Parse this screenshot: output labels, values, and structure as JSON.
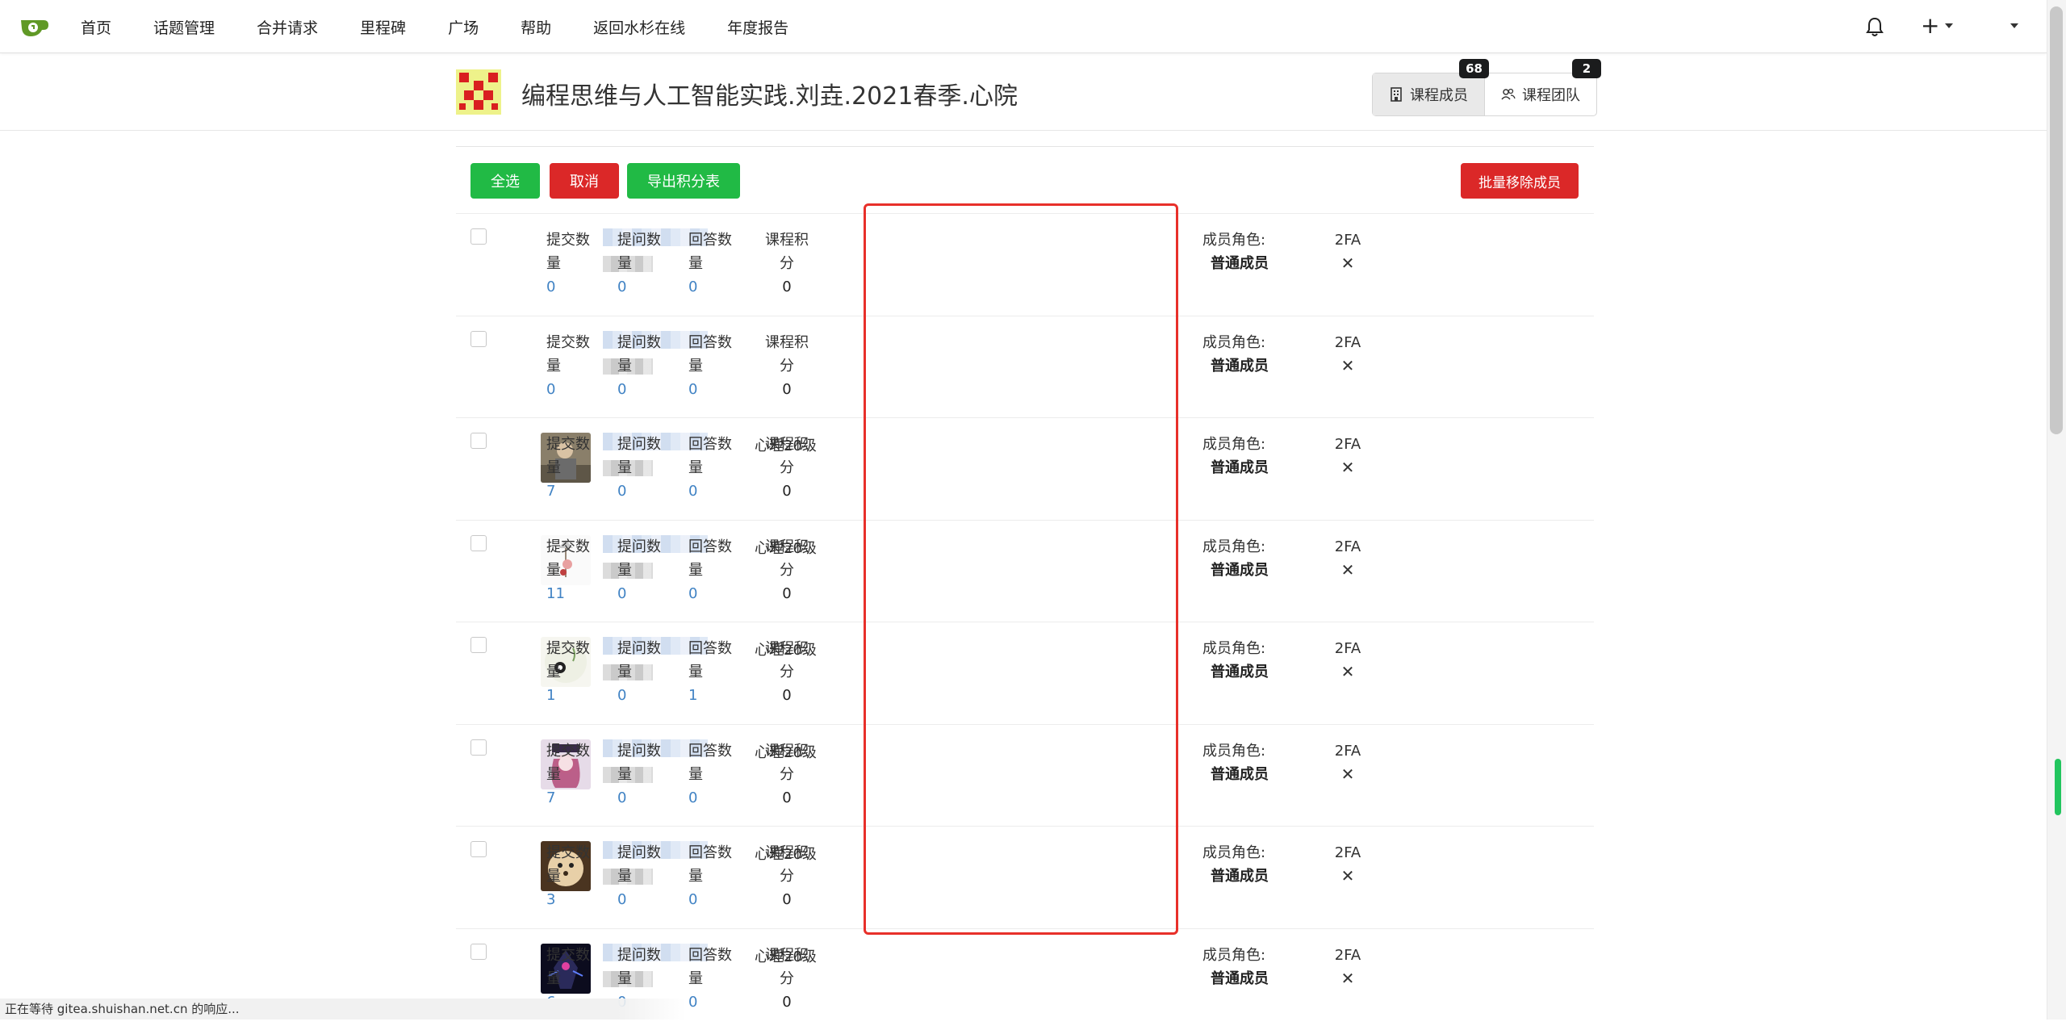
{
  "nav": {
    "items": [
      "首页",
      "话题管理",
      "合并请求",
      "里程碑",
      "广场",
      "帮助",
      "返回水杉在线",
      "年度报告"
    ]
  },
  "header": {
    "course_title": "编程思维与人工智能实践.刘垚.2021春季.心院",
    "members_label": "课程成员",
    "members_count": "68",
    "team_label": "课程团队",
    "team_count": "2"
  },
  "toolbar": {
    "select_all": "全选",
    "cancel": "取消",
    "export": "导出积分表",
    "batch_remove": "批量移除成员"
  },
  "labels": {
    "commits": "提交数量",
    "questions": "提问数量",
    "answers": "回答数量",
    "score": "课程积分",
    "role": "成员角色:",
    "twofa": "2FA",
    "twofa_status": "✕"
  },
  "members": [
    {
      "group": "",
      "commits": "0",
      "questions": "0",
      "answers": "0",
      "score": "0",
      "role": "普通成员",
      "avatar": "none"
    },
    {
      "group": "",
      "commits": "0",
      "questions": "0",
      "answers": "0",
      "score": "0",
      "role": "普通成员",
      "avatar": "none"
    },
    {
      "group": "心理20级",
      "commits": "7",
      "questions": "0",
      "answers": "0",
      "score": "0",
      "role": "普通成员",
      "avatar": "photo-elder"
    },
    {
      "group": "心理20级",
      "commits": "11",
      "questions": "0",
      "answers": "0",
      "score": "0",
      "role": "普通成员",
      "avatar": "illustration-flower"
    },
    {
      "group": "心理20级",
      "commits": "1",
      "questions": "0",
      "answers": "1",
      "score": "0",
      "role": "普通成员",
      "avatar": "panda"
    },
    {
      "group": "心理20级",
      "commits": "7",
      "questions": "0",
      "answers": "0",
      "score": "0",
      "role": "普通成员",
      "avatar": "anime-girl"
    },
    {
      "group": "心理20级",
      "commits": "3",
      "questions": "0",
      "answers": "0",
      "score": "0",
      "role": "普通成员",
      "avatar": "dog"
    },
    {
      "group": "心理20级",
      "commits": "6",
      "questions": "0",
      "answers": "0",
      "score": "0",
      "role": "普通成员",
      "avatar": "dark-robot"
    }
  ],
  "status_bar": "正在等待 gitea.shuishan.net.cn 的响应...",
  "colors": {
    "green": "#21ba45",
    "red": "#db2828",
    "link": "#4183c4",
    "highlight": "#e8302a"
  }
}
